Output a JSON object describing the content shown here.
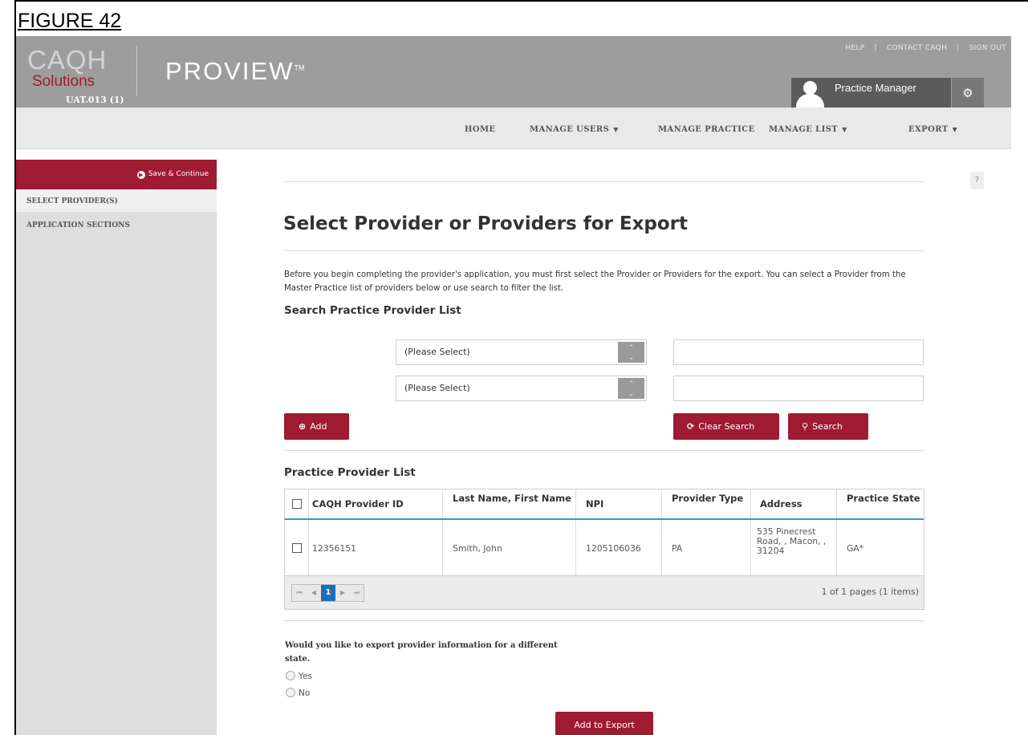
{
  "figure_label": "FIGURE 42",
  "header": {
    "logo_caqh": "CAQH",
    "logo_solutions": "Solutions",
    "env_label": "UAT.013 (1)",
    "product": "PROVIEW",
    "product_tm": "TM",
    "links": {
      "help": "HELP",
      "contact": "CONTACT CAQH",
      "sign_out": "SIGN OUT"
    },
    "user_role": "Practice Manager"
  },
  "nav": {
    "home": "HOME",
    "manage_users": "MANAGE USERS",
    "manage_practice": "MANAGE PRACTICE",
    "manage_list": "MANAGE LIST",
    "export": "EXPORT"
  },
  "sidebar": {
    "save_continue": "Save & Continue",
    "select_providers": "SELECT PROVIDER(S)",
    "application_sections": "APPLICATION SECTIONS"
  },
  "main": {
    "title": "Select Provider or Providers for Export",
    "intro": "Before you begin completing the provider's application, you must first select the Provider or Providers for the export. You can select a Provider from the Master Practice list of providers below or use search to filter the list.",
    "search_title": "Search Practice Provider List",
    "select1": "(Please Select)",
    "select2": "(Please Select)",
    "add_label": "Add",
    "clear_search_label": "Clear Search",
    "search_label": "Search",
    "list_title": "Practice Provider List"
  },
  "table": {
    "headers": {
      "id": "CAQH Provider ID",
      "name": "Last Name, First Name",
      "npi": "NPI",
      "type": "Provider Type",
      "address": "Address",
      "state": "Practice State"
    },
    "rows": [
      {
        "id": "12356151",
        "name": "Smith, John",
        "npi": "1205106036",
        "type": "PA",
        "address": "535 Pinecrest Road, , Macon, , 31204",
        "state": "GA*"
      }
    ],
    "pager": {
      "current_page": "1",
      "info": "1 of 1 pages (1 items)"
    }
  },
  "export_state": {
    "question": "Would you like to export provider information for a different state.",
    "yes": "Yes",
    "no": "No"
  },
  "add_to_export": "Add to Export",
  "colors": {
    "brand_red": "#9e1b32",
    "header_gray": "#9d9d9d",
    "link_blue": "#1b6eb8"
  }
}
